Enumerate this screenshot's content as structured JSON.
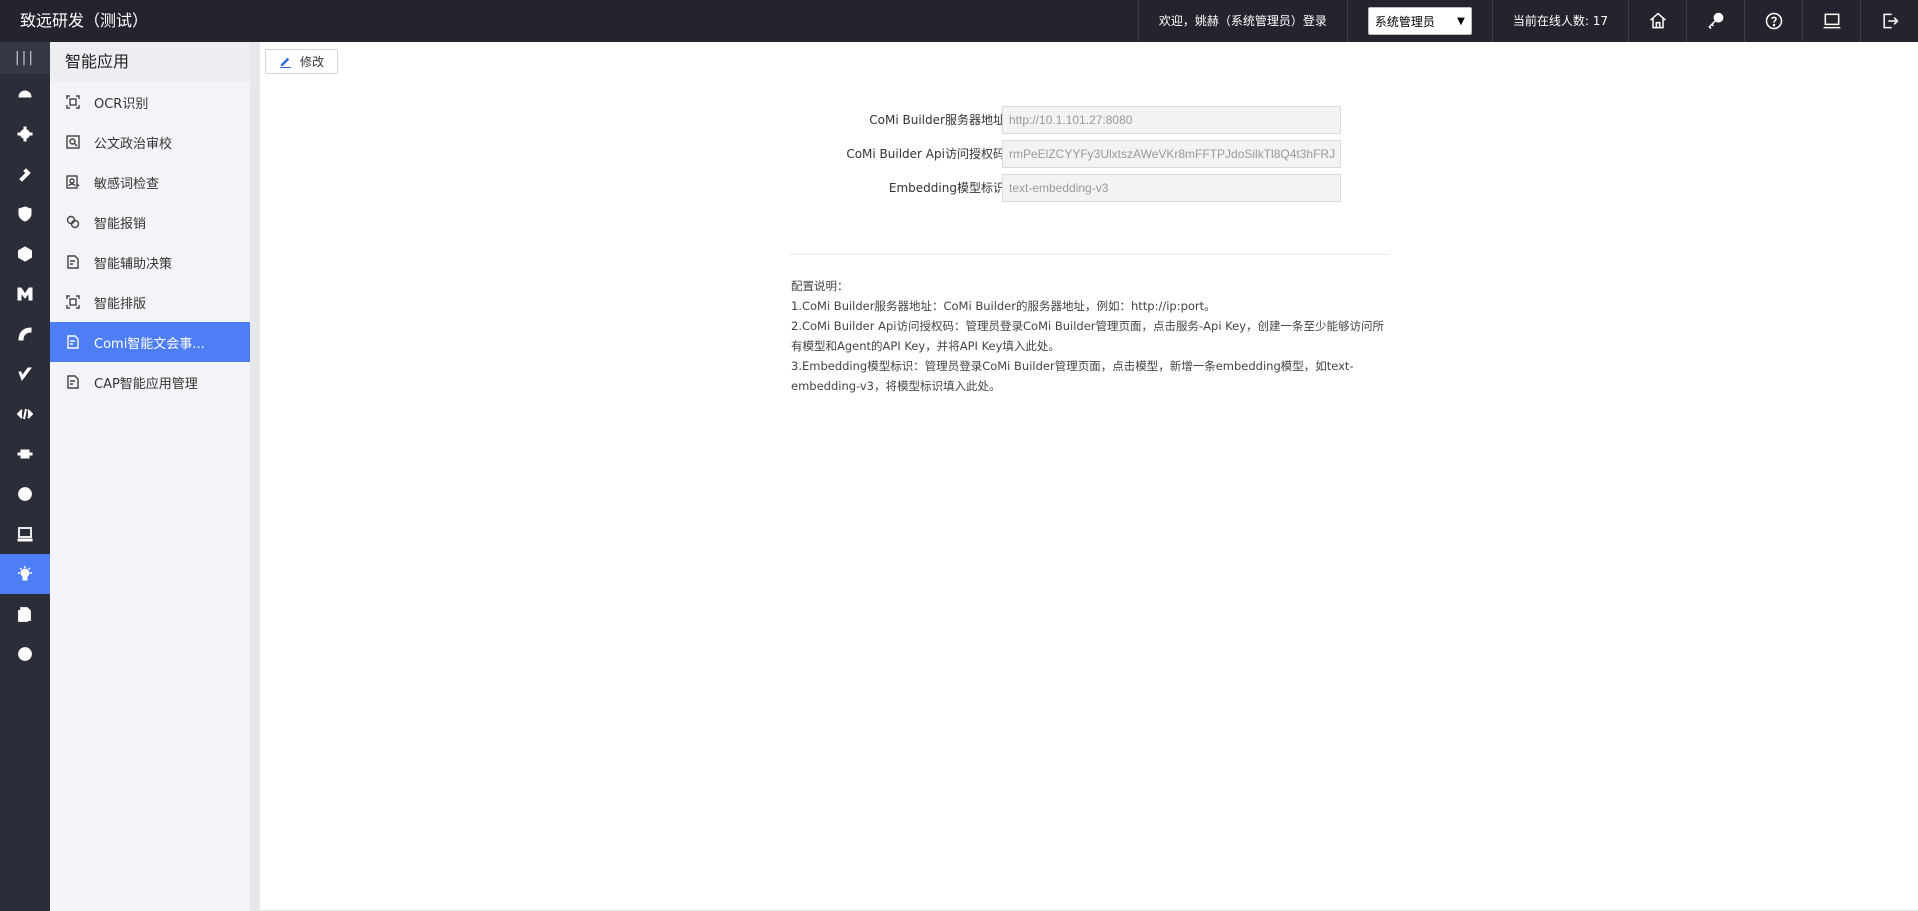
{
  "header": {
    "app_title": "致远研发（测试）",
    "welcome_text": "欢迎，姚赫（系统管理员）登录",
    "role_selected": "系统管理员",
    "online_text": "当前在线人数: 17",
    "icons": [
      "home-icon",
      "key-icon",
      "help-icon",
      "monitor-icon",
      "logout-icon"
    ]
  },
  "rail": {
    "toggle_glyph": "|||",
    "icons": [
      "dashboard-icon",
      "gear-icon",
      "puzzle-icon",
      "shield-icon",
      "hexagon-icon",
      "m-logo-icon",
      "chart-icon",
      "check-mark-icon",
      "code-icon",
      "chip-icon",
      "cube-icon",
      "terminal-icon",
      "bulb-icon",
      "document-icon",
      "at-icon"
    ],
    "active_icon": "bulb-icon",
    "active_color": "#4d7ef5"
  },
  "subnav": {
    "title": "智能应用",
    "items": [
      {
        "label": "OCR识别",
        "icon": "scan-icon"
      },
      {
        "label": "公文政治审校",
        "icon": "search-doc-icon"
      },
      {
        "label": "敏感词检查",
        "icon": "person-doc-icon"
      },
      {
        "label": "智能报销",
        "icon": "coins-icon"
      },
      {
        "label": "智能辅助决策",
        "icon": "doc-check-icon"
      },
      {
        "label": "智能排版",
        "icon": "scan-icon"
      },
      {
        "label": "Comi智能文会事...",
        "icon": "doc-check-icon",
        "active": true
      },
      {
        "label": "CAP智能应用管理",
        "icon": "doc-check-icon"
      }
    ]
  },
  "toolbar": {
    "edit_label": "修改"
  },
  "form": {
    "server_label": "CoMi Builder服务器地址:",
    "server_value": "http://10.1.101.27:8080",
    "api_label": "CoMi Builder Api访问授权码:",
    "api_value": "rmPeElZCYYFy3UlxtszAWeVKr8mFFTPJdoSilkTl8Q4t3hFRJ",
    "embedding_label": "Embedding模型标识:",
    "embedding_value": "text-embedding-v3"
  },
  "notes": {
    "title": "配置说明：",
    "line1": "1.CoMi Builder服务器地址：CoMi Builder的服务器地址，例如：http://ip:port。",
    "line2": "2.CoMi Builder Api访问授权码：管理员登录CoMi Builder管理页面，点击服务-Api Key，创建一条至少能够访问所有模型和Agent的API Key，并将API Key填入此处。",
    "line3": "3.Embedding模型标识：管理员登录CoMi Builder管理页面，点击模型，新增一条embedding模型，如text-embedding-v3，将模型标识填入此处。"
  }
}
